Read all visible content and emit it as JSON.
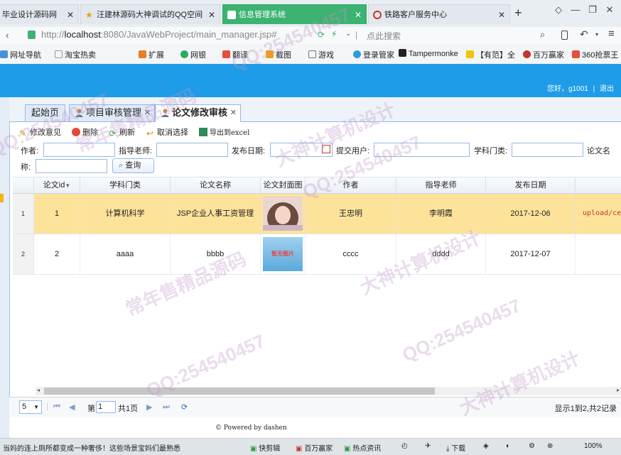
{
  "browser": {
    "tabs": [
      {
        "title": "毕业设计源码网",
        "active": false
      },
      {
        "title": "汪建林源码大神调试的QQ空间",
        "active": false
      },
      {
        "title": "信息管理系统",
        "active": true
      },
      {
        "title": "铁路客户服务中心",
        "active": false
      }
    ],
    "new_tab": "+",
    "url_prefix": "http://",
    "url_host": "localhost",
    "url_rest": ":8080/JavaWebProject/main_manager.jsp#",
    "search_placeholder": "点此搜索",
    "bookmarks": [
      "网址导航",
      "淘宝热卖",
      "扩展",
      "网银",
      "翻译",
      "截图",
      "游戏",
      "登录管家",
      "Tampermonke",
      "【有范】全",
      "百万赢家",
      "360抢票王"
    ]
  },
  "header": {
    "greeting": "您好，",
    "user": "g1001",
    "separator": "|",
    "logout": "退出"
  },
  "app_tabs": [
    {
      "label": "起始页",
      "closable": false,
      "active": false
    },
    {
      "label": "项目审核管理",
      "closable": true,
      "active": false
    },
    {
      "label": "论文修改审核",
      "closable": true,
      "active": true
    }
  ],
  "toolbar": {
    "edit": "修改意见",
    "delete": "删除",
    "refresh": "刷新",
    "cancel_select": "取消选择",
    "export": "导出到excel"
  },
  "search": {
    "author_label": "作者:",
    "teacher_label": "指导老师:",
    "date_label": "发布日期:",
    "user_label": "提交用户:",
    "category_label": "学科门类:",
    "title_label_a": "论文名",
    "title_label_b": "称:",
    "query_button": "查询"
  },
  "grid": {
    "columns": [
      "论文id",
      "学科门类",
      "论文名称",
      "论文封面图",
      "作者",
      "指导老师",
      "发布日期"
    ],
    "sort_indicator": "▼",
    "rows": [
      {
        "num": "1",
        "id": "1",
        "category": "计算机科学",
        "title": "JSP企业人事工资管理",
        "author": "王忠明",
        "teacher": "李明霞",
        "date": "2017-12-06",
        "file": "upload/ce",
        "cover": "photo",
        "selected": true
      },
      {
        "num": "2",
        "id": "2",
        "category": "aaaa",
        "title": "bbbb",
        "author": "cccc",
        "teacher": "dddd",
        "date": "2017-12-07",
        "file": "",
        "cover": "暂无图片",
        "selected": false
      }
    ]
  },
  "pager": {
    "page_size": "5",
    "page_label": "第",
    "page_value": "1",
    "page_total": "共1页",
    "summary": "显示1到2,共2记录"
  },
  "footer": {
    "text": "© Powered by dashen"
  },
  "statusbar": {
    "news": "当妈的连上厕所都变成一种奢侈！这些场景宝妈们最熟悉",
    "items": [
      "快剪辑",
      "百万赢家",
      "热点资讯",
      "下载"
    ],
    "zoom": "100%"
  },
  "watermark": {
    "text_a": "QQ:254540457",
    "text_b": "大神计算机设计",
    "text_c": "常年售精品源码"
  },
  "colors": {
    "header_blue": "#1e9ce8",
    "active_browser_tab": "#3cb371",
    "selected_row": "#fde39a",
    "grid_border": "#95b8e7"
  }
}
